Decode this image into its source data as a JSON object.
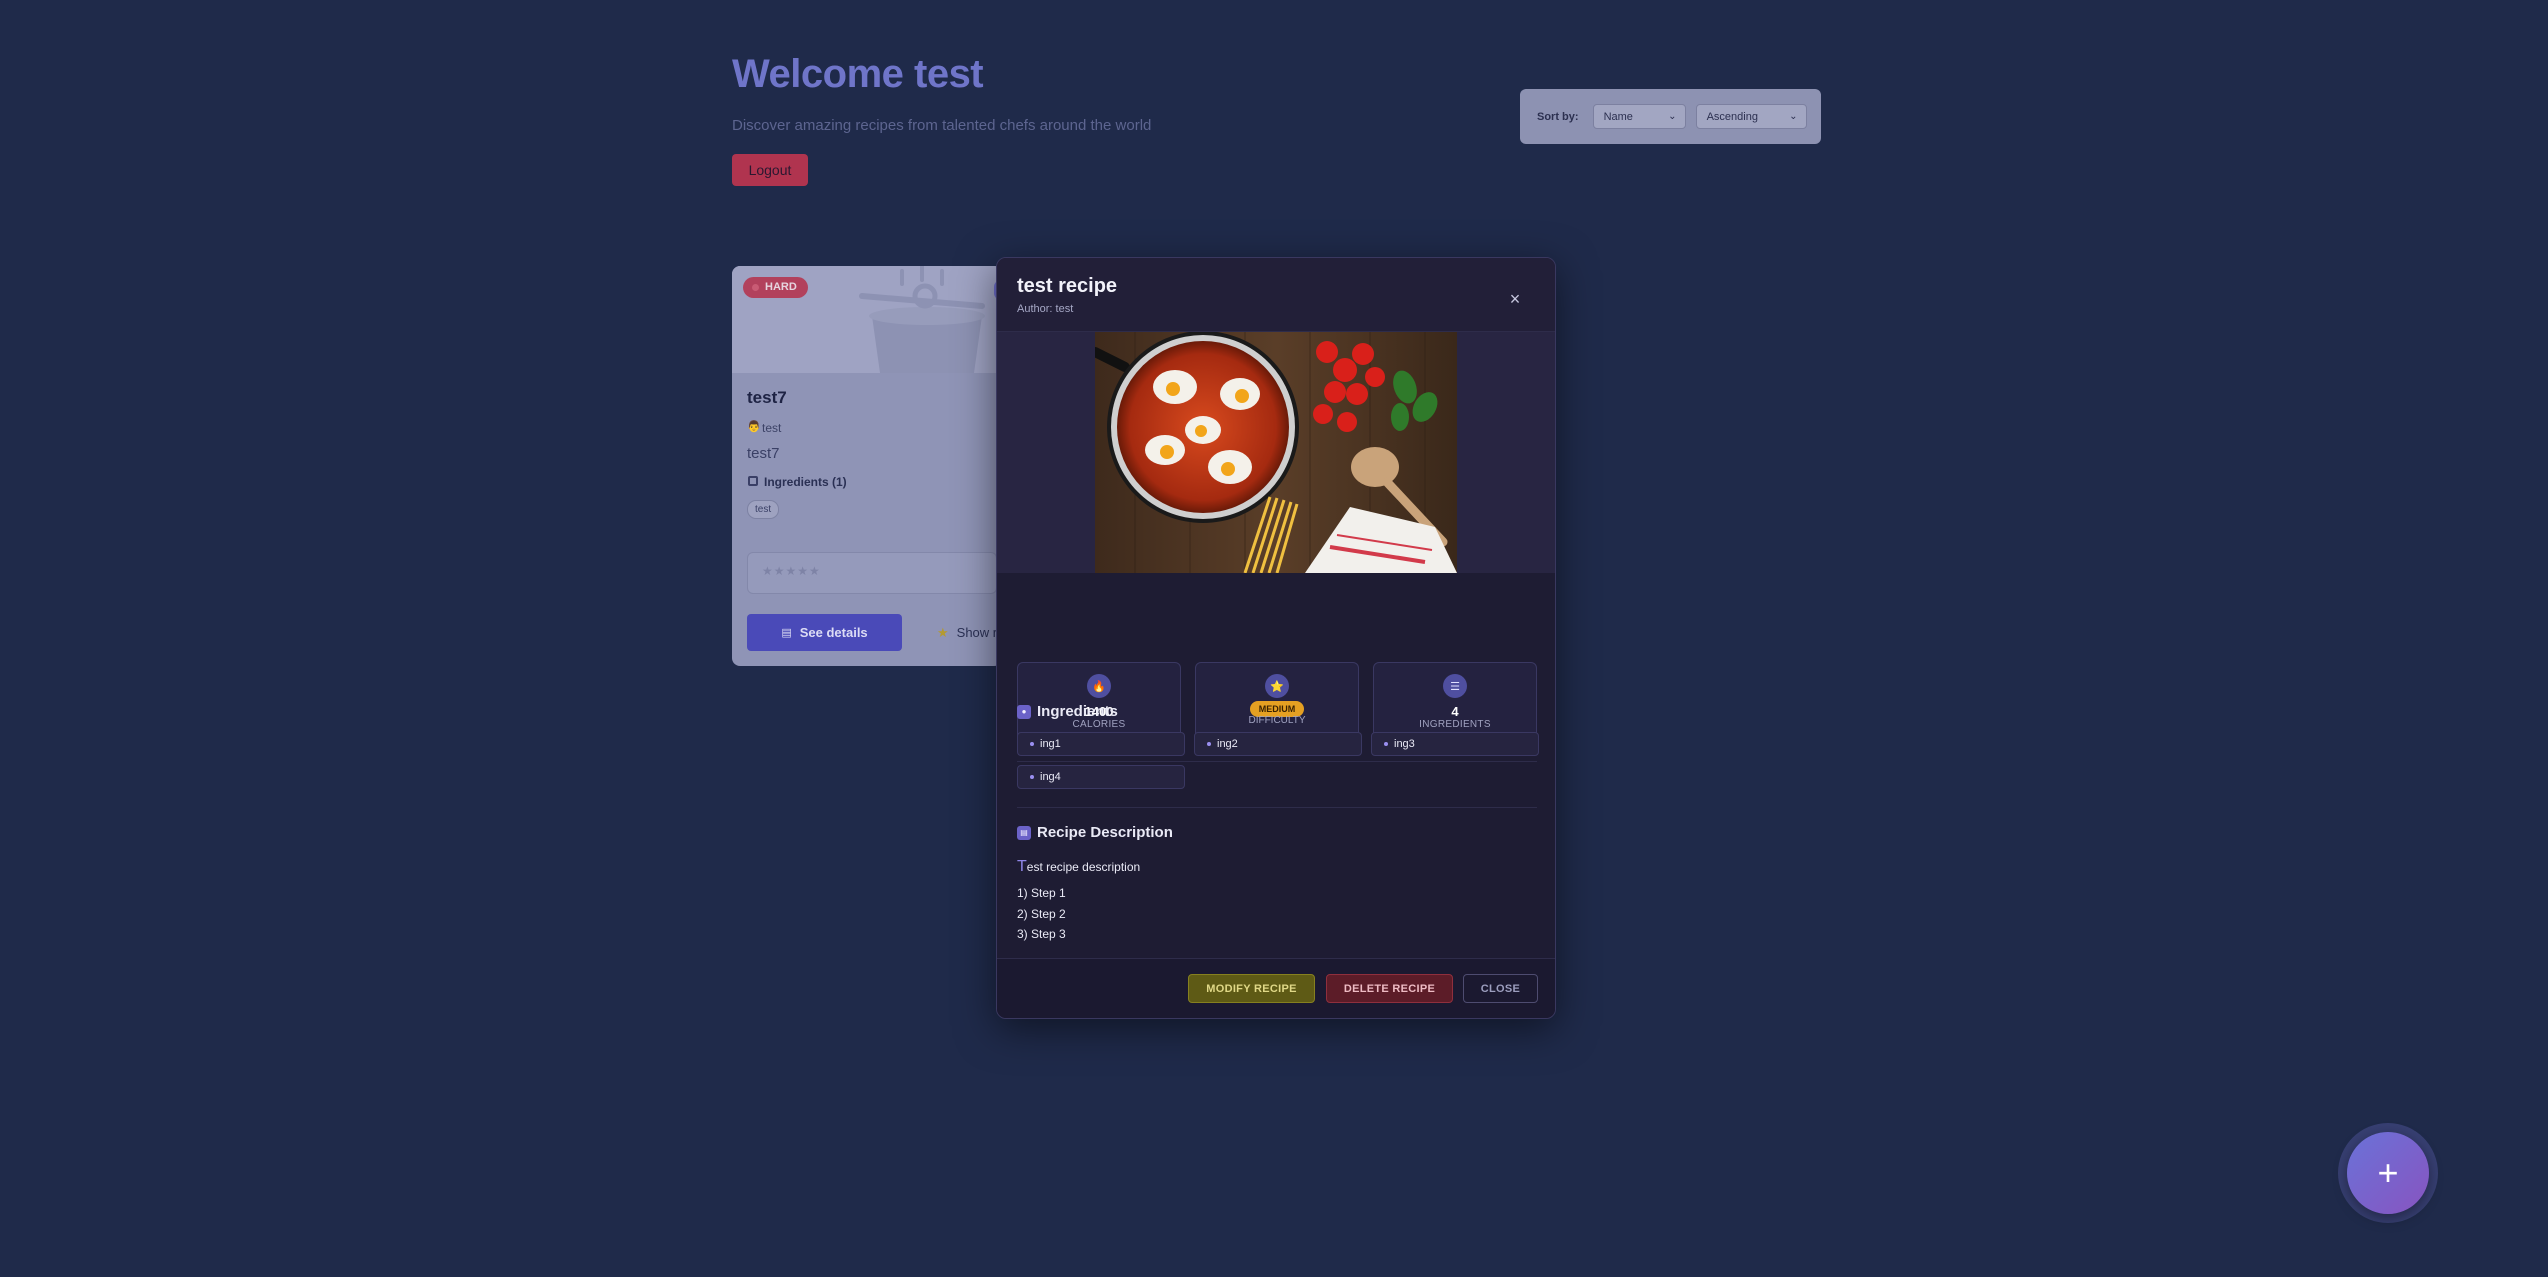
{
  "header": {
    "welcome": "Welcome test",
    "subtitle": "Discover amazing recipes from talented chefs around the world",
    "logout_label": "Logout"
  },
  "sort": {
    "label": "Sort by:",
    "field_value": "Name",
    "order_value": "Ascending"
  },
  "card": {
    "difficulty": "HARD",
    "title": "test7",
    "author": "test",
    "description": "test7",
    "ingredients_label": "Ingredients (1)",
    "tag": "test",
    "rating": "★★★★★",
    "details_label": "See details",
    "show_label": "Show r"
  },
  "modal": {
    "title": "test recipe",
    "author": "Author: test",
    "close_x": "×",
    "stats": {
      "calories_value": "1400",
      "calories_label": "CALORIES",
      "difficulty_value": "MEDIUM",
      "difficulty_label": "DIFFICULTY",
      "ingredients_value": "4",
      "ingredients_label": "INGREDIENTS"
    },
    "ingredients_title": "Ingredients",
    "ingredients": [
      "ing1",
      "ing2",
      "ing3",
      "ing4"
    ],
    "description_title": "Recipe Description",
    "description_dropcap": "T",
    "description_rest": "est recipe description",
    "steps": [
      "1) Step 1",
      "2) Step 2",
      "3) Step 3"
    ],
    "buttons": {
      "modify": "MODIFY RECIPE",
      "delete": "DELETE RECIPE",
      "close": "CLOSE"
    }
  },
  "fab": {
    "label": "+"
  },
  "icons": {
    "calories": "fire-icon",
    "difficulty": "star-icon",
    "ingredients": "list-icon",
    "section_ingredients": "leaf-icon",
    "section_description": "document-icon"
  },
  "colors": {
    "background": "#1f2a4a",
    "accent": "#6f75c9",
    "logout": "#b0344f",
    "difficulty_medium": "#e5a022",
    "difficulty_hard": "#b2415c",
    "modify": "#5e5a15",
    "delete": "#5c1c28"
  }
}
